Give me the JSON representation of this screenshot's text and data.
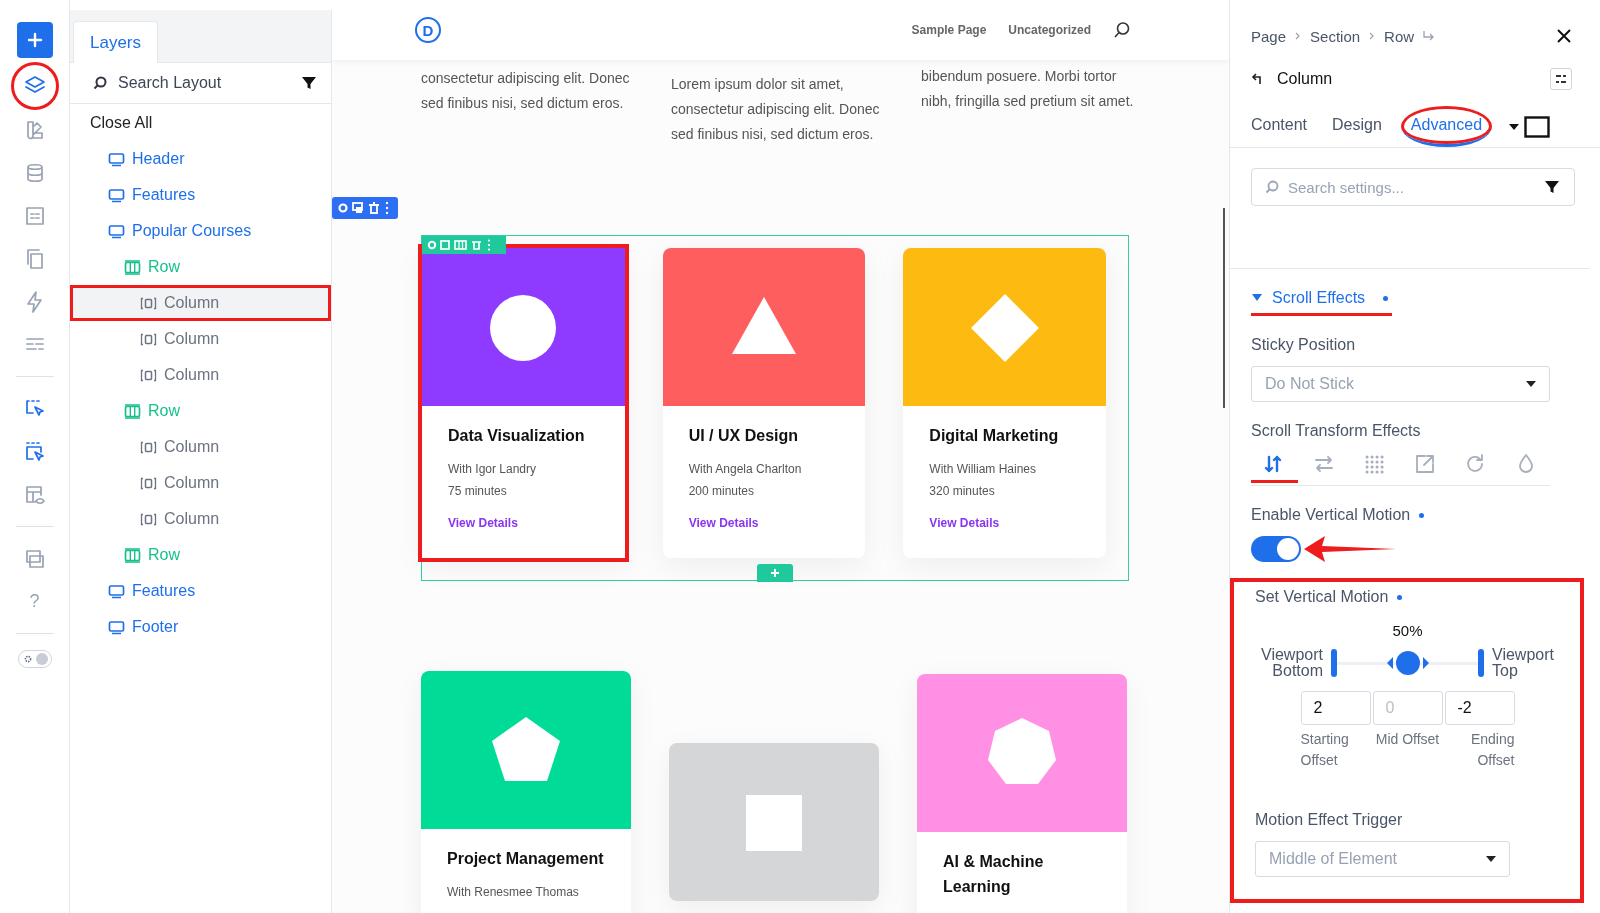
{
  "rail": {
    "items": [
      {
        "kind": "add"
      },
      {
        "kind": "icon",
        "annotated": true
      },
      {
        "kind": "icon",
        "annotated": false
      },
      {
        "kind": "icon",
        "annotated": false
      },
      {
        "kind": "icon",
        "annotated": false
      },
      {
        "kind": "icon",
        "annotated": false
      },
      {
        "kind": "icon",
        "annotated": false
      },
      {
        "kind": "icon",
        "annotated": false
      },
      {
        "kind": "divider"
      },
      {
        "kind": "icon",
        "annotated": false
      },
      {
        "kind": "icon",
        "annotated": false
      },
      {
        "kind": "icon",
        "annotated": false
      },
      {
        "kind": "divider"
      },
      {
        "kind": "icon",
        "annotated": false
      },
      {
        "kind": "help",
        "label": "?"
      },
      {
        "kind": "divider"
      },
      {
        "kind": "switch",
        "on": false
      }
    ]
  },
  "layers": {
    "tabs": [
      {
        "label": "Layers",
        "selected": true
      }
    ],
    "search": {
      "placeholder": "Search Layout"
    },
    "close_all": "Close All",
    "tree": [
      {
        "label": "Header",
        "kind": "section",
        "selected": false,
        "annotated": false
      },
      {
        "label": "Features",
        "kind": "section",
        "selected": false,
        "annotated": false
      },
      {
        "label": "Popular Courses",
        "kind": "section",
        "selected": false,
        "annotated": false,
        "children": [
          {
            "label": "Row",
            "kind": "row",
            "selected": false,
            "annotated": false,
            "children": [
              {
                "label": "Column",
                "kind": "column",
                "selected": true,
                "annotated": true
              },
              {
                "label": "Column",
                "kind": "column",
                "selected": false,
                "annotated": false
              },
              {
                "label": "Column",
                "kind": "column",
                "selected": false,
                "annotated": false
              }
            ]
          },
          {
            "label": "Row",
            "kind": "row",
            "selected": false,
            "annotated": false,
            "children": [
              {
                "label": "Column",
                "kind": "column",
                "selected": false,
                "annotated": false
              },
              {
                "label": "Column",
                "kind": "column",
                "selected": false,
                "annotated": false
              },
              {
                "label": "Column",
                "kind": "column",
                "selected": false,
                "annotated": false
              }
            ]
          },
          {
            "label": "Row",
            "kind": "row",
            "selected": false,
            "annotated": false
          }
        ]
      },
      {
        "label": "Features",
        "kind": "section",
        "selected": false,
        "annotated": false
      },
      {
        "label": "Footer",
        "kind": "section",
        "selected": false,
        "annotated": false
      }
    ]
  },
  "canvas": {
    "header": {
      "logo": "D",
      "nav": [
        "Sample Page",
        "Uncategorized"
      ]
    },
    "text_columns": [
      "consectetur adipiscing elit. Donec sed finibus nisi, sed dictum eros.",
      "Lorem ipsum dolor sit amet, consectetur adipiscing elit. Donec sed finibus nisi, sed dictum eros.",
      "bibendum posuere. Morbi tortor nibh, fringilla sed pretium sit amet."
    ],
    "rows": [
      {
        "cards": [
          {
            "kind": "circle",
            "color": "#8e3bff",
            "title": "Data Visualization",
            "instructor": "With Igor Landry",
            "duration": "75 minutes",
            "link": "View Details",
            "annotated": true
          },
          {
            "kind": "triangle",
            "color": "#ff5e5e",
            "title": "UI / UX Design",
            "instructor": "With Angela Charlton",
            "duration": "200 minutes",
            "link": "View Details",
            "annotated": false
          },
          {
            "kind": "diamond",
            "color": "#fdbb12",
            "title": "Digital Marketing",
            "instructor": "With William Haines",
            "duration": "320 minutes",
            "link": "View Details",
            "annotated": false
          }
        ]
      },
      {
        "cards": [
          {
            "kind": "pentagon",
            "color": "#00dc97",
            "title": "Project Management",
            "instructor": "With Renesmee Thomas",
            "annotated": false
          },
          {
            "kind": "square",
            "color": "#d5d6d8",
            "annotated": false
          },
          {
            "kind": "heptagon",
            "color": "#ff90e4",
            "title": "AI & Machine Learning",
            "annotated": false
          }
        ]
      }
    ]
  },
  "settings": {
    "breadcrumb": [
      "Page",
      "Section",
      "Row"
    ],
    "title": "Column",
    "tabs": [
      {
        "label": "Content",
        "selected": false,
        "annotated": false
      },
      {
        "label": "Design",
        "selected": false,
        "annotated": false
      },
      {
        "label": "Advanced",
        "selected": true,
        "annotated": true
      }
    ],
    "search": {
      "placeholder": "Search settings..."
    },
    "section": {
      "label": "Scroll Effects",
      "expanded": true,
      "modified": true,
      "annotated": true
    },
    "sticky": {
      "label": "Sticky Position",
      "value": "Do Not Stick"
    },
    "transform": {
      "label": "Scroll Transform Effects",
      "effects": [
        {
          "selected": true,
          "annotated": true
        },
        {
          "selected": false,
          "annotated": false
        },
        {
          "selected": false,
          "annotated": false
        },
        {
          "selected": false,
          "annotated": false
        },
        {
          "selected": false,
          "annotated": false
        },
        {
          "selected": false,
          "annotated": false
        }
      ]
    },
    "vertical_toggle": {
      "label": "Enable Vertical Motion",
      "modified": true,
      "on": true,
      "annotated": true
    },
    "vertical_motion": {
      "label": "Set Vertical Motion",
      "modified": true,
      "annotated": true,
      "reading": "50%",
      "level": 0.5,
      "left_label": "Viewport Bottom",
      "right_label": "Viewport Top",
      "offsets": [
        {
          "value": "2",
          "label": "Starting Offset"
        },
        {
          "placeholder": "0",
          "label": "Mid Offset"
        },
        {
          "value": "-2",
          "label": "Ending Offset"
        }
      ]
    },
    "trigger": {
      "label": "Motion Effect Trigger",
      "value": "Middle of Element"
    }
  }
}
